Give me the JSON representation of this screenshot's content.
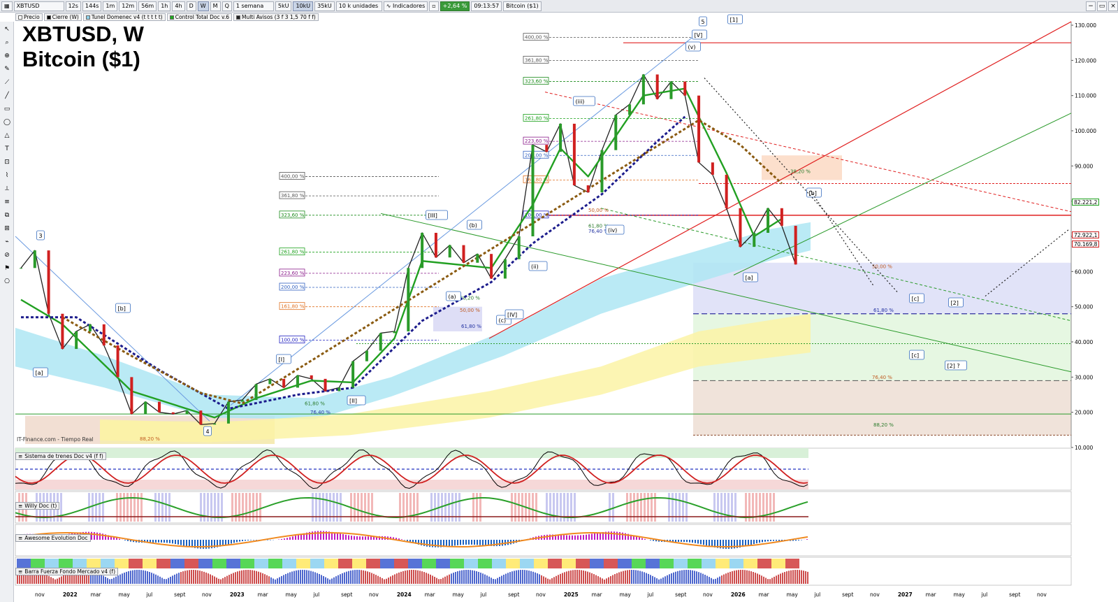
{
  "toolbar": {
    "symbol": "XBTUSD",
    "timeframes": [
      "12s",
      "144s",
      "1m",
      "12m",
      "56m",
      "1h",
      "4h",
      "D",
      "W",
      "M",
      "Q"
    ],
    "active_timeframe": "W",
    "period_select": "1 semana",
    "units": [
      "5kU",
      "10kU",
      "35kU"
    ],
    "active_unit": "10kU",
    "units_select": "10 k unidades",
    "indicators_label": "Indicadores",
    "change": "+2,64 %",
    "time": "09:13:57",
    "instrument": "Bitcoin ($1)"
  },
  "overlays": [
    "Precio",
    "Cierre (W)",
    "Tunel Domenec v4 (t t t t t)",
    "Control Total Doc v.6",
    "Multi Avisos (3 f 3 1,5 70 f f)"
  ],
  "title": {
    "line1": "XBTUSD, W",
    "line2": "Bitcoin ($1)"
  },
  "source": "IT-Finance.com - Tiempo Real",
  "panels": [
    "Sistema de trenes Doc v4 (f f)",
    "Willy Doc (t)",
    "Awesome Evolution Doc",
    "Barra Fuerza Fondo Mercado v4 (f)"
  ],
  "price_tags": [
    {
      "label": "82.221,2",
      "value": 82221,
      "color": "#1aa01a"
    },
    {
      "label": "72.922,1",
      "value": 72922,
      "color": "#d02020"
    },
    {
      "label": "70.169,8",
      "value": 70169,
      "color": "#d02020"
    }
  ],
  "chart_data": {
    "type": "line",
    "title": "XBTUSD, W",
    "subtitle": "Bitcoin ($1)",
    "y_ticks": [
      130000,
      120000,
      110000,
      100000,
      90000,
      80000,
      70000,
      60000,
      50000,
      40000,
      30000,
      20000,
      10000
    ],
    "y_tick_labels": [
      "130.000",
      "120.000",
      "110.000",
      "100.000",
      "90.000",
      "80.000",
      "70.000",
      "60.000",
      "50.000",
      "40.000",
      "30.000",
      "20.000",
      "10.000"
    ],
    "ylim": [
      10000,
      131000
    ],
    "x_tick_labels": [
      "nov",
      "2022",
      "mar",
      "may",
      "jul",
      "sept",
      "nov",
      "2023",
      "mar",
      "may",
      "jul",
      "sept",
      "nov",
      "2024",
      "mar",
      "may",
      "jul",
      "sept",
      "nov",
      "2025",
      "mar",
      "may",
      "jul",
      "sept",
      "nov",
      "2026",
      "mar",
      "may",
      "jul",
      "sept",
      "nov",
      "2027",
      "mar",
      "may",
      "jul",
      "sept",
      "nov"
    ],
    "x_range": [
      "2021-10",
      "2027-12"
    ],
    "series": [
      {
        "name": "Precio",
        "color": "#222222",
        "points": [
          [
            "2021-10",
            61000
          ],
          [
            "2021-11",
            66000
          ],
          [
            "2021-12",
            48000
          ],
          [
            "2022-01",
            38000
          ],
          [
            "2022-02",
            43000
          ],
          [
            "2022-03",
            45000
          ],
          [
            "2022-04",
            39000
          ],
          [
            "2022-05",
            30000
          ],
          [
            "2022-06",
            19500
          ],
          [
            "2022-07",
            23000
          ],
          [
            "2022-08",
            20000
          ],
          [
            "2022-09",
            19500
          ],
          [
            "2022-10",
            20500
          ],
          [
            "2022-11",
            16500
          ],
          [
            "2022-12",
            16800
          ],
          [
            "2023-01",
            23000
          ],
          [
            "2023-02",
            23500
          ],
          [
            "2023-03",
            28000
          ],
          [
            "2023-04",
            29500
          ],
          [
            "2023-05",
            27000
          ],
          [
            "2023-06",
            30500
          ],
          [
            "2023-07",
            29500
          ],
          [
            "2023-08",
            26000
          ],
          [
            "2023-09",
            27000
          ],
          [
            "2023-10",
            34500
          ],
          [
            "2023-11",
            37500
          ],
          [
            "2023-12",
            42500
          ],
          [
            "2024-01",
            43000
          ],
          [
            "2024-02",
            61000
          ],
          [
            "2024-03",
            71000
          ],
          [
            "2024-04",
            64000
          ],
          [
            "2024-05",
            67500
          ],
          [
            "2024-06",
            62500
          ],
          [
            "2024-07",
            65000
          ],
          [
            "2024-08",
            58000
          ],
          [
            "2024-09",
            63500
          ],
          [
            "2024-10",
            70000
          ],
          [
            "2024-11",
            96000
          ],
          [
            "2024-12",
            94000
          ],
          [
            "2025-01",
            102000
          ],
          [
            "2025-02",
            84500
          ],
          [
            "2025-03",
            82500
          ],
          [
            "2025-04",
            94500
          ],
          [
            "2025-05",
            104500
          ],
          [
            "2025-06",
            107500
          ],
          [
            "2025-07",
            116000
          ],
          [
            "2025-08",
            109000
          ],
          [
            "2025-09",
            114000
          ],
          [
            "2025-10",
            110000
          ],
          [
            "2025-11",
            91000
          ],
          [
            "2025-12",
            87500
          ],
          [
            "2026-01",
            78000
          ],
          [
            "2026-02",
            67000
          ],
          [
            "2026-03",
            71000
          ],
          [
            "2026-04",
            78000
          ],
          [
            "2026-05",
            73000
          ],
          [
            "2026-06",
            62000
          ]
        ]
      },
      {
        "name": "",
        "color": "#22a022",
        "points": [
          [
            "2021-10",
            52000
          ],
          [
            "2022-01",
            45000
          ],
          [
            "2022-06",
            26000
          ],
          [
            "2022-12",
            18500
          ],
          [
            "2023-03",
            24000
          ],
          [
            "2023-07",
            29000
          ],
          [
            "2023-10",
            28500
          ],
          [
            "2024-01",
            41000
          ],
          [
            "2024-03",
            63000
          ],
          [
            "2024-08",
            61000
          ],
          [
            "2024-11",
            79000
          ],
          [
            "2025-01",
            95000
          ],
          [
            "2025-03",
            87000
          ],
          [
            "2025-07",
            110000
          ],
          [
            "2025-10",
            112000
          ],
          [
            "2026-01",
            88000
          ],
          [
            "2026-03",
            70000
          ],
          [
            "2026-05",
            75000
          ]
        ]
      },
      {
        "name": "",
        "color": "#1c1c8c",
        "points": [
          [
            "2021-10",
            47000
          ],
          [
            "2022-02",
            47000
          ],
          [
            "2022-08",
            32000
          ],
          [
            "2023-01",
            21000
          ],
          [
            "2023-06",
            25000
          ],
          [
            "2023-10",
            27000
          ],
          [
            "2024-03",
            46000
          ],
          [
            "2024-08",
            57000
          ],
          [
            "2024-11",
            68000
          ],
          [
            "2025-04",
            82000
          ],
          [
            "2025-08",
            97000
          ],
          [
            "2025-10",
            104000
          ]
        ]
      },
      {
        "name": "",
        "color": "#8a5a10",
        "points": [
          [
            "2022-01",
            47000
          ],
          [
            "2022-06",
            36000
          ],
          [
            "2022-11",
            25500
          ],
          [
            "2023-02",
            22500
          ],
          [
            "2025-11",
            103000
          ],
          [
            "2026-02",
            96000
          ],
          [
            "2026-05",
            85000
          ]
        ]
      }
    ],
    "fib_levels": [
      {
        "label": "400,00 %",
        "value": 87000
      },
      {
        "label": "361,80 %",
        "value": 81500
      },
      {
        "label": "323,60 %",
        "value": 76000
      },
      {
        "label": "261,80 %",
        "value": 65500
      },
      {
        "label": "223,60 %",
        "value": 59500
      },
      {
        "label": "200,00 %",
        "value": 55500
      },
      {
        "label": "161,80 %",
        "value": 50000
      },
      {
        "label": "100,00 %",
        "value": 40500
      },
      {
        "label": "400,00 %",
        "value": 126500
      },
      {
        "label": "361,80 %",
        "value": 120000
      },
      {
        "label": "323,60 %",
        "value": 114000
      },
      {
        "label": "261,80 %",
        "value": 103500
      },
      {
        "label": "223,60 %",
        "value": 97000
      },
      {
        "label": "200,00 %",
        "value": 93000
      },
      {
        "label": "161,80 %",
        "value": 86000
      },
      {
        "label": "100,00 %",
        "value": 76000
      }
    ],
    "retracement_labels": [
      "88,20 %",
      "61,80 %",
      "76,40 %",
      "50,00 %",
      "38,20 %",
      "61,80 %",
      "50,00 %",
      "61,80 %",
      "76,40 %",
      "50,00 %",
      "38,20 %",
      "61,80 %",
      "76,40 %",
      "88,20 %"
    ],
    "wave_labels": [
      "3",
      "[b]",
      "[a]",
      "4",
      "[I]",
      "[II]",
      "[III]",
      "(b)",
      "(a)",
      "(c)",
      "[IV]",
      "(ii)",
      "(iii)",
      "(iv)",
      "5",
      "[V]",
      "(v)",
      "[1]",
      "[a]",
      "[b]",
      "[c]",
      "[c]",
      "[2]",
      "[2] ?"
    ]
  }
}
